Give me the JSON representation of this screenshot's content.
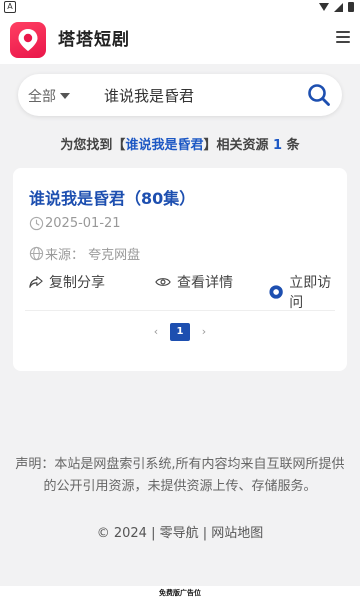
{
  "status_bar": {
    "indicator": "A"
  },
  "header": {
    "title": "塔塔短剧"
  },
  "search": {
    "category": "全部",
    "value": "谁说我是昏君"
  },
  "summary": {
    "prefix": "为您找到【",
    "keyword": "谁说我是昏君",
    "middle": "】相关资源 ",
    "count": "1",
    "suffix": " 条"
  },
  "result": {
    "title": "谁说我是昏君（80集）",
    "date": "2025-01-21",
    "source": "来源：  夸克网盘",
    "actions": {
      "share": "复制分享",
      "detail": "查看详情",
      "visit": "立即访问"
    }
  },
  "pagination": {
    "prev": "‹",
    "current": "1",
    "next": "›"
  },
  "footer": {
    "disclaimer": "声明：本站是网盘索引系统,所有内容均来自互联网所提供的公开引用资源，未提供资源上传、存储服务。",
    "links": "© 2024 | 零导航 | 网站地图"
  },
  "ad": {
    "label": "免费版广告位"
  },
  "colors": {
    "brand": "#e9164a",
    "accent": "#1d4fb0",
    "background": "#f2f2f3"
  }
}
